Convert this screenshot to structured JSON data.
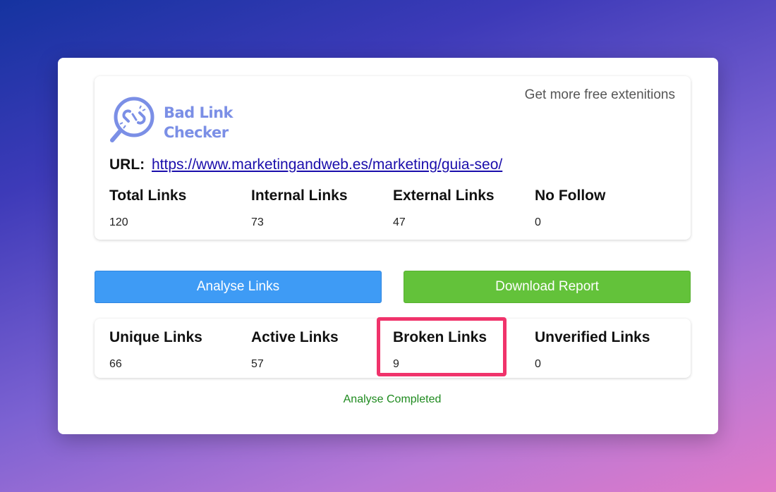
{
  "logo": {
    "line1": "Bad Link",
    "line2": "Checker",
    "color": "#7b8fe6"
  },
  "header": {
    "more_link": "Get more free extenitions"
  },
  "url": {
    "label": "URL:",
    "value": "https://www.marketingandweb.es/marketing/guia-seo/"
  },
  "summary": [
    {
      "label": "Total Links",
      "value": "120"
    },
    {
      "label": "Internal Links",
      "value": "73"
    },
    {
      "label": "External Links",
      "value": "47"
    },
    {
      "label": "No Follow",
      "value": "0"
    }
  ],
  "buttons": {
    "analyse": "Analyse Links",
    "download": "Download Report",
    "analyse_color": "#3e9bf5",
    "download_color": "#63c23a"
  },
  "results": [
    {
      "label": "Unique Links",
      "value": "66"
    },
    {
      "label": "Active Links",
      "value": "57"
    },
    {
      "label": "Broken Links",
      "value": "9"
    },
    {
      "label": "Unverified Links",
      "value": "0"
    }
  ],
  "status": {
    "text": "Analyse Completed",
    "color": "#1e8a1e"
  },
  "highlight_color": "#f0336b"
}
